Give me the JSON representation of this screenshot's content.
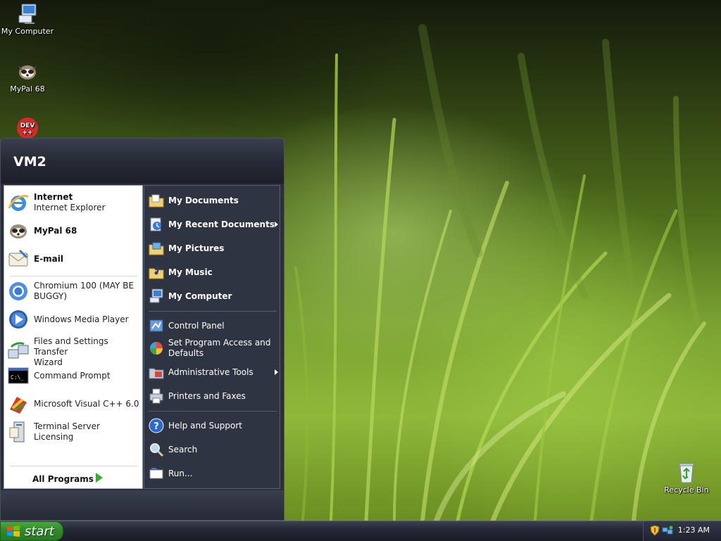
{
  "desktop": {
    "icons": [
      {
        "label": "My Computer",
        "icon": "my-computer-icon"
      },
      {
        "label": "MyPal 68",
        "icon": "mypal-icon"
      },
      {
        "label": "",
        "icon": "devcpp-icon"
      },
      {
        "label": "Recycle Bin",
        "icon": "recycle-bin-icon"
      }
    ]
  },
  "start_menu": {
    "user_name": "VM2",
    "pinned": [
      {
        "title": "Internet",
        "subtitle": "Internet Explorer",
        "icon": "internet-explorer-icon"
      },
      {
        "title": "MyPal 68",
        "subtitle": "",
        "icon": "mypal-icon"
      },
      {
        "title": "E-mail",
        "subtitle": "",
        "icon": "email-icon"
      }
    ],
    "recent": [
      {
        "label_line1": "Chromium 100 (MAY BE",
        "label_line2": "BUGGY)",
        "icon": "chromium-icon"
      },
      {
        "label_line1": "Windows Media Player",
        "label_line2": "",
        "icon": "media-player-icon"
      },
      {
        "label_line1": "Files and Settings Transfer",
        "label_line2": "Wizard",
        "icon": "transfer-wizard-icon"
      },
      {
        "label_line1": "Command Prompt",
        "label_line2": "",
        "icon": "command-prompt-icon"
      },
      {
        "label_line1": "Microsoft Visual C++ 6.0",
        "label_line2": "",
        "icon": "visual-cpp-icon"
      },
      {
        "label_line1": "Terminal Server Licensing",
        "label_line2": "",
        "icon": "terminal-licensing-icon"
      }
    ],
    "all_programs": "All Programs",
    "places": [
      {
        "label": "My Documents",
        "icon": "folder-documents-icon",
        "submenu": false
      },
      {
        "label": "My Recent Documents",
        "icon": "recent-documents-icon",
        "submenu": true
      },
      {
        "label": "My Pictures",
        "icon": "folder-pictures-icon",
        "submenu": false
      },
      {
        "label": "My Music",
        "icon": "folder-music-icon",
        "submenu": false
      },
      {
        "label": "My Computer",
        "icon": "my-computer-icon",
        "submenu": false
      }
    ],
    "settings": [
      {
        "label_line1": "Control Panel",
        "label_line2": "",
        "icon": "control-panel-icon",
        "submenu": false
      },
      {
        "label_line1": "Set Program Access and",
        "label_line2": "Defaults",
        "icon": "program-access-icon",
        "submenu": false
      },
      {
        "label_line1": "Administrative Tools",
        "label_line2": "",
        "icon": "admin-tools-icon",
        "submenu": true
      },
      {
        "label_line1": "Printers and Faxes",
        "label_line2": "",
        "icon": "printer-icon",
        "submenu": false
      }
    ],
    "help": [
      {
        "label": "Help and Support",
        "icon": "help-icon"
      },
      {
        "label": "Search",
        "icon": "search-icon"
      },
      {
        "label": "Run...",
        "icon": "run-icon"
      }
    ]
  },
  "taskbar": {
    "start_label": "start",
    "clock": "1:23 AM",
    "tray_icons": [
      "security-shield-icon",
      "network-icon"
    ]
  }
}
